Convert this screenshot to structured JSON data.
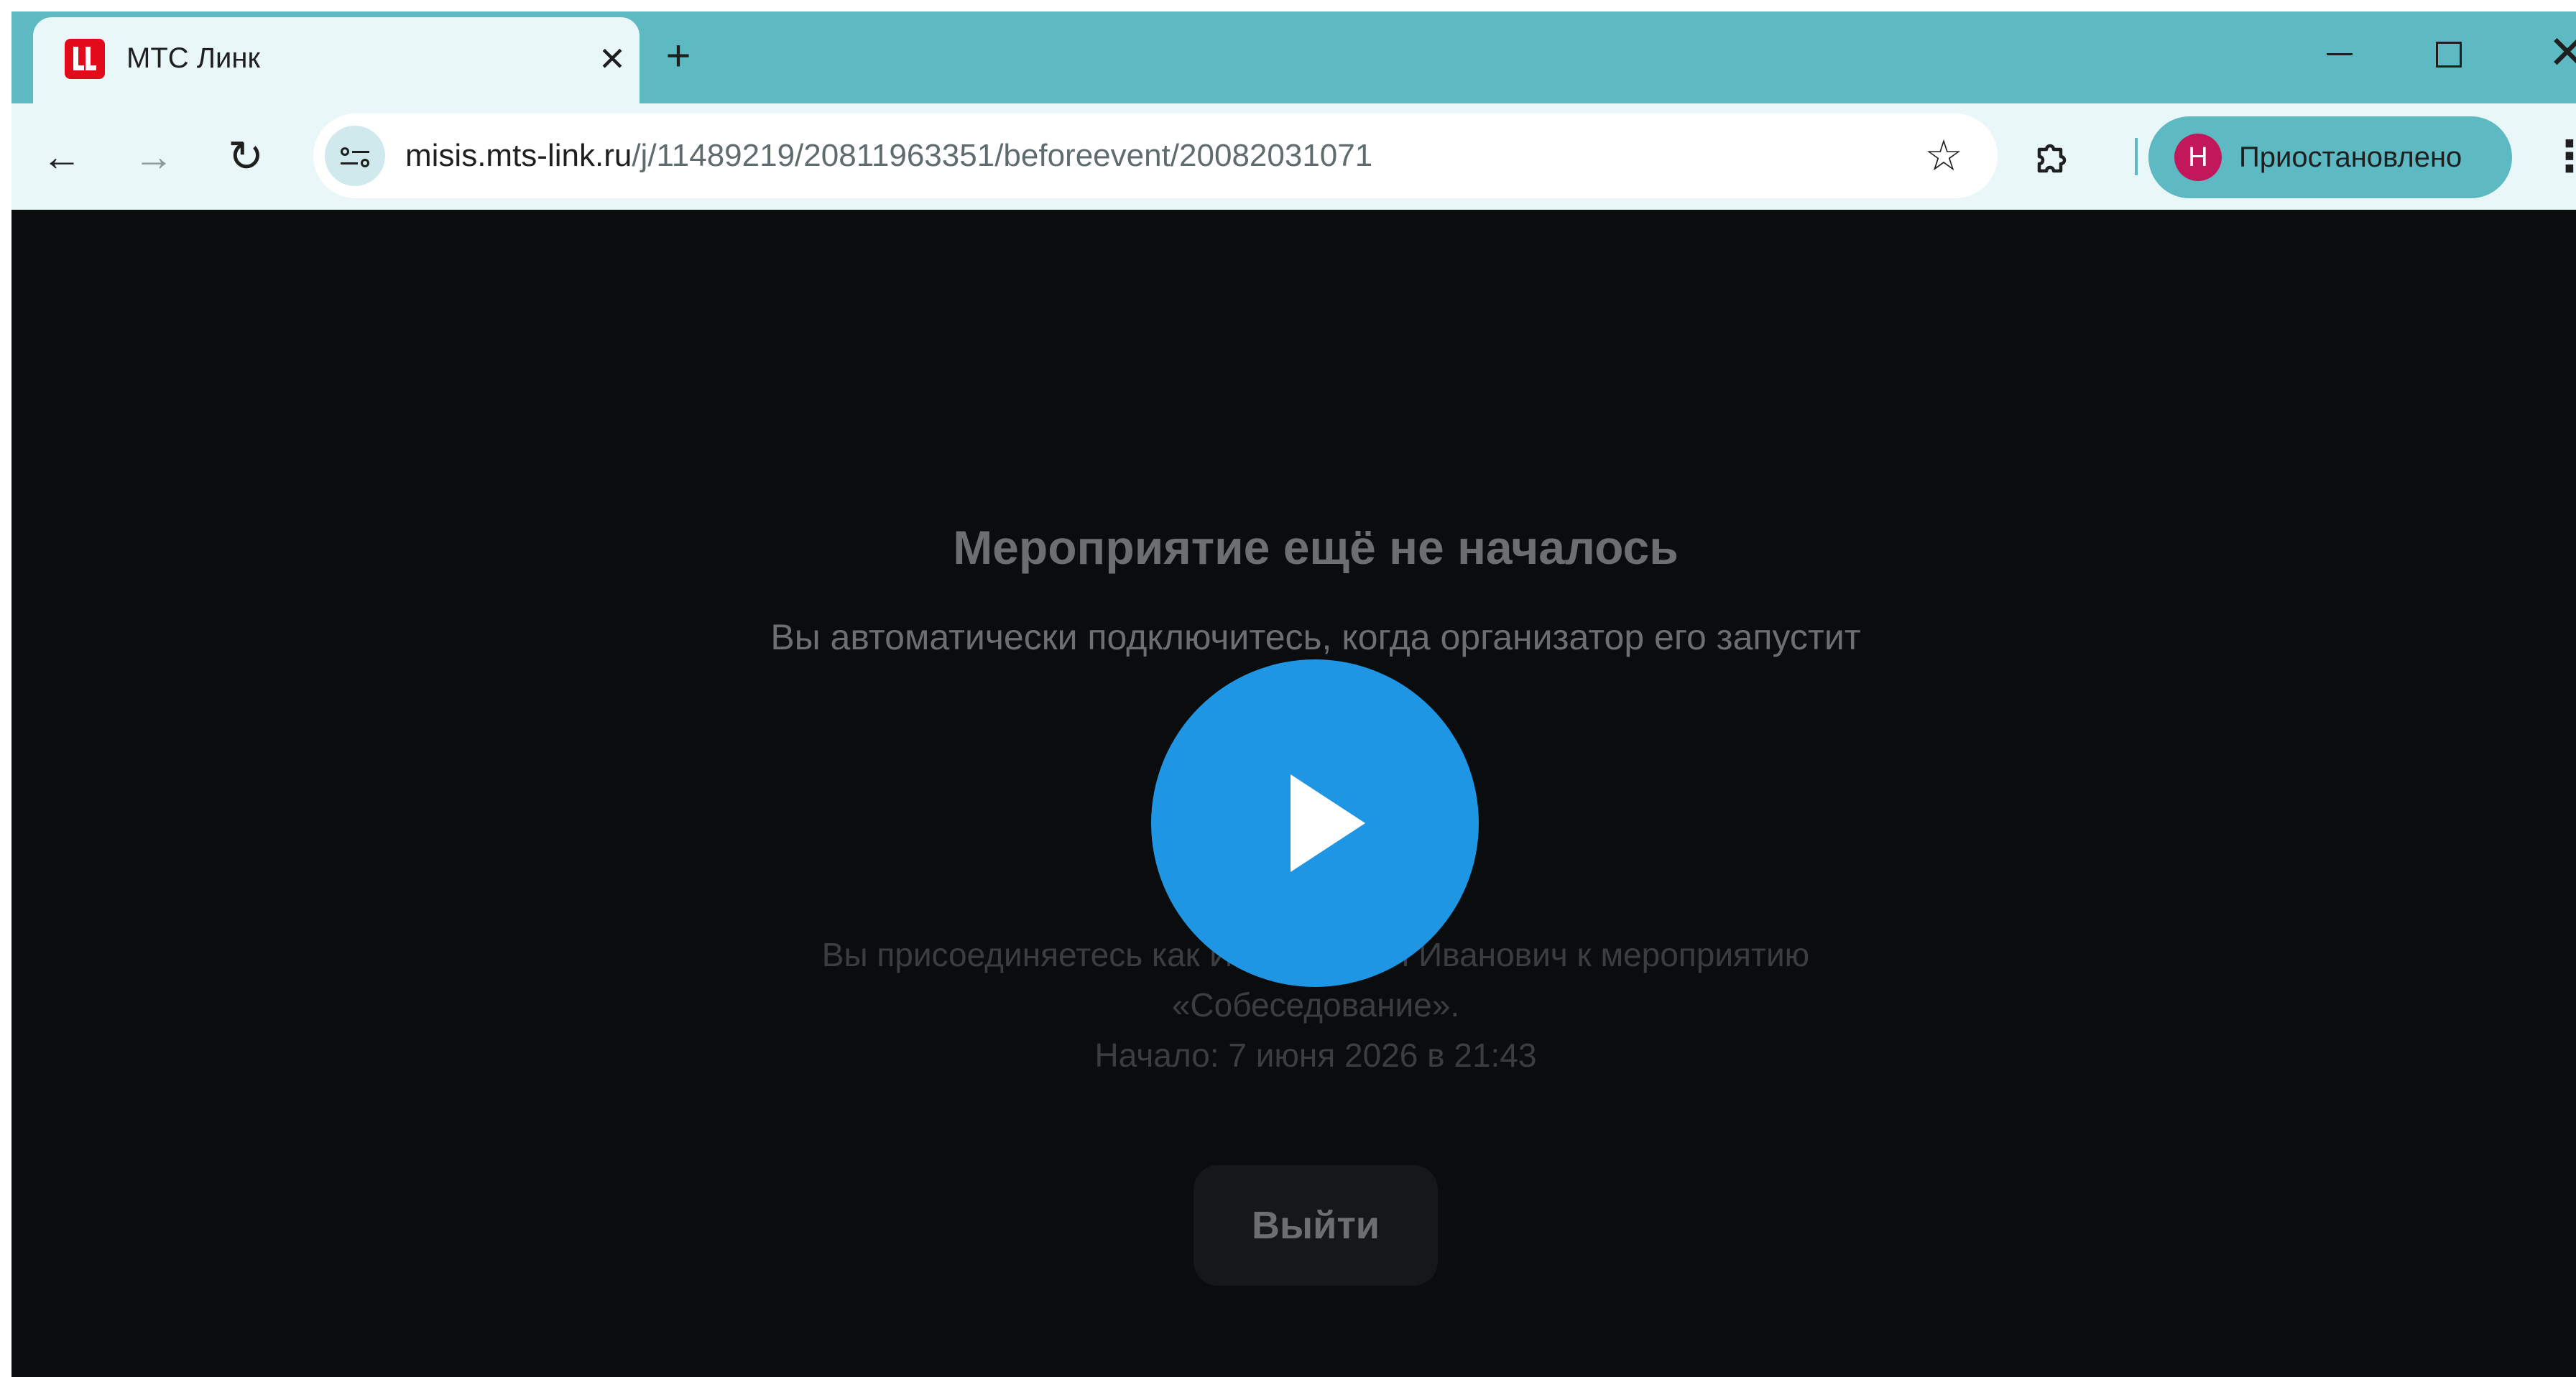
{
  "browser": {
    "tab": {
      "title": "МТС Линк",
      "favicon": "mts-link-logo-icon",
      "close_symbol": "✕"
    },
    "new_tab_symbol": "+",
    "window_controls": {
      "minimize": "minimize-icon",
      "maximize": "maximize-icon",
      "close_symbol": "✕"
    },
    "toolbar": {
      "back_symbol": "←",
      "forward_symbol": "→",
      "reload_symbol": "↻",
      "url_host": "misis.mts-link.ru",
      "url_path": "/j/11489219/20811963351/beforeevent/20082031071",
      "bookmark_symbol": "☆",
      "extensions_icon": "puzzle-icon",
      "profile": {
        "initial": "Н",
        "label": "Приостановлено",
        "avatar_color": "#c2185b"
      },
      "menu_symbol": "⋮"
    },
    "colors": {
      "tabstrip": "#5db9c2",
      "toolbar": "#e9f7f8"
    }
  },
  "page": {
    "title": "Мероприятие ещё не началось",
    "subtitle": "Вы автоматически подключитесь, когда организатор его запустит",
    "join_info": {
      "line1": "Вы присоединяетесь как Иванов Иван Иванович к мероприятию",
      "line2": "«Собеседование».",
      "line3": "Начало: 7 июня 2026 в 21:43"
    },
    "exit_button": "Выйти",
    "play_overlay": {
      "icon": "play-icon",
      "color": "#1e96e3"
    },
    "background": "#0b0c0e"
  }
}
